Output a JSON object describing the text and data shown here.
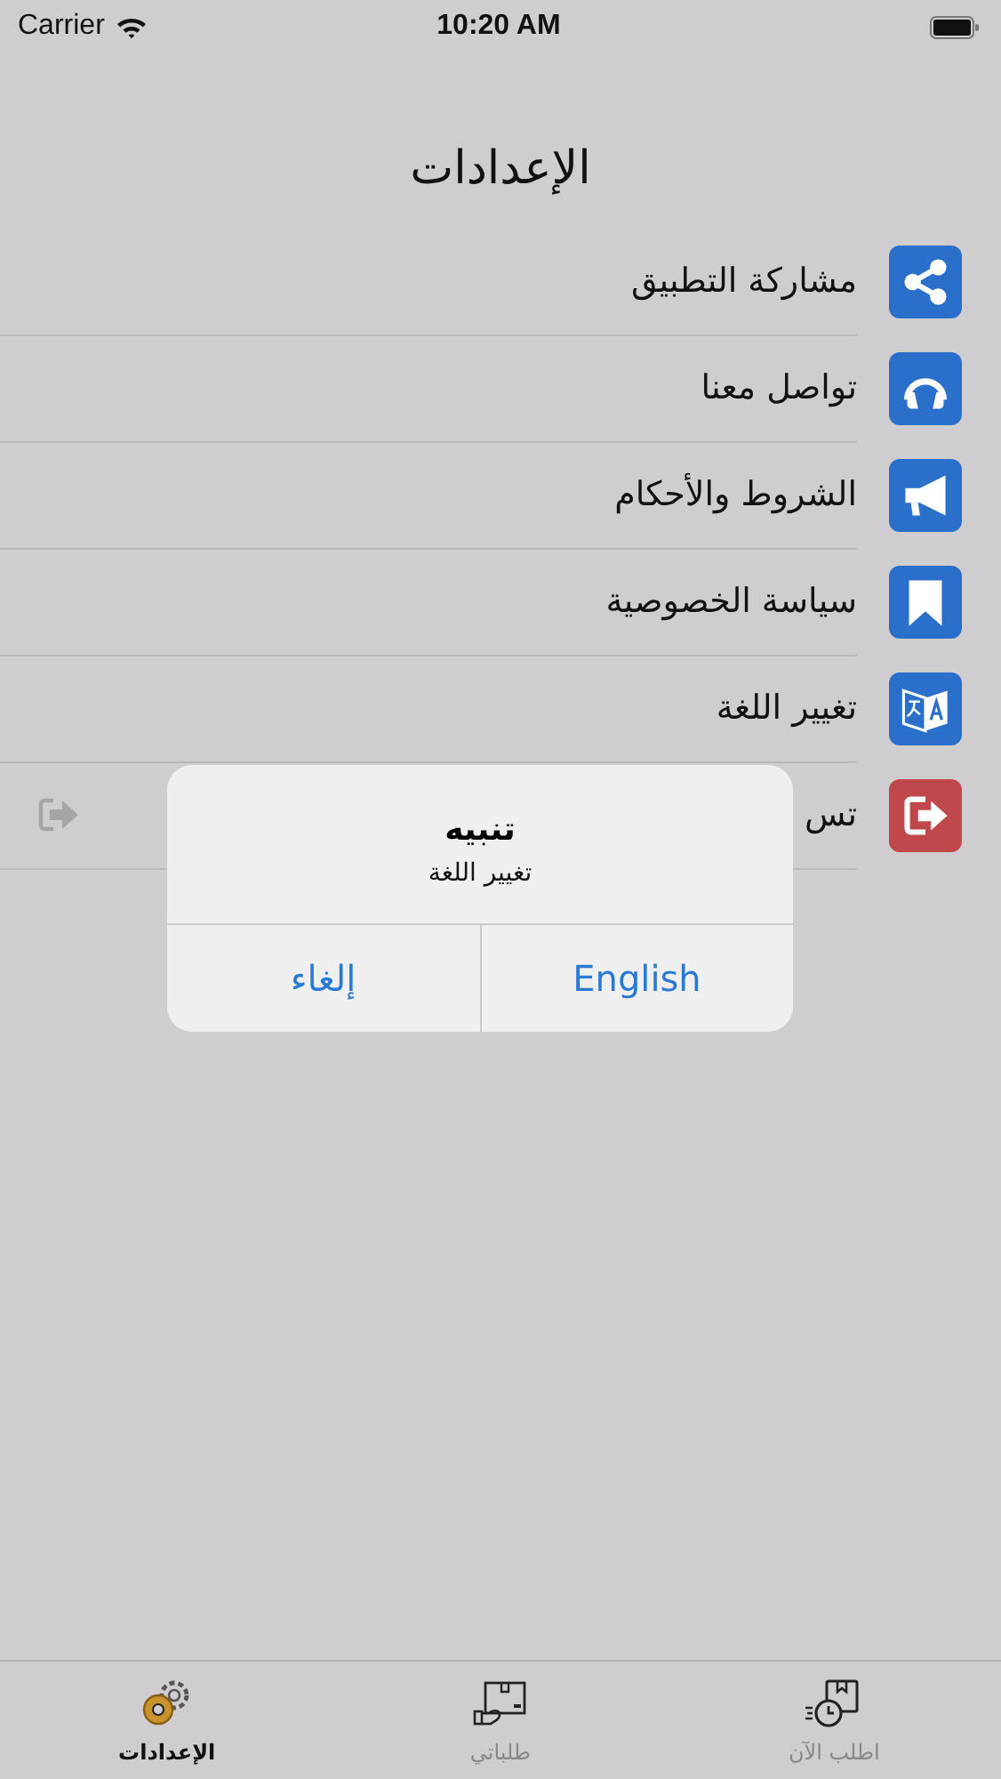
{
  "status_bar": {
    "carrier": "Carrier",
    "time": "10:20 AM"
  },
  "title": "الإعدادات",
  "settings": [
    {
      "label": "مشاركة التطبيق",
      "kind": "share",
      "color": "#2a6fc9"
    },
    {
      "label": "تواصل معنا",
      "kind": "headphones",
      "color": "#2a6fc9"
    },
    {
      "label": "الشروط والأحكام",
      "kind": "megaphone",
      "color": "#2a6fc9"
    },
    {
      "label": "سياسة الخصوصية",
      "kind": "bookmark",
      "color": "#2a6fc9"
    },
    {
      "label": "تغيير اللغة",
      "kind": "translate",
      "color": "#2a6fc9"
    },
    {
      "label": "تس",
      "kind": "logout",
      "color": "#c0474b"
    }
  ],
  "alert": {
    "title": "تنبيه",
    "message": "تغيير اللغة",
    "buttons": [
      {
        "label": "English"
      },
      {
        "label": "إلغاء"
      }
    ]
  },
  "tabs": [
    {
      "label": "اطلب الآن",
      "kind": "order",
      "selected": false
    },
    {
      "label": "طلباتي",
      "kind": "orders",
      "selected": false
    },
    {
      "label": "الإعدادات",
      "kind": "settings",
      "selected": true
    }
  ]
}
